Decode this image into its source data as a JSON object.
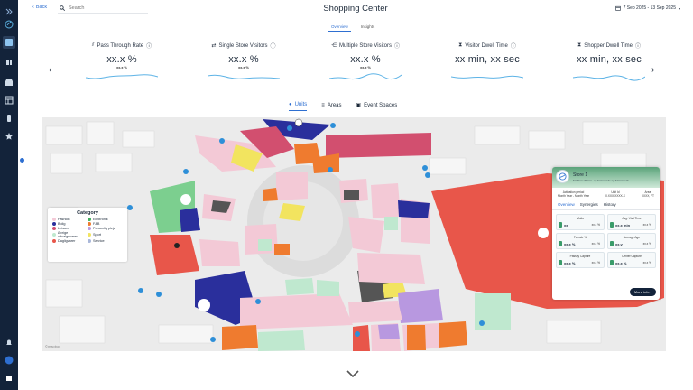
{
  "app": {
    "back_label": "Back",
    "search_placeholder": "Search",
    "title": "Shopping Center",
    "date_range": "7 Sep 2025 - 13 Sep 2025"
  },
  "subtabs": [
    {
      "label": "Overview",
      "active": true
    },
    {
      "label": "Insights",
      "active": false
    }
  ],
  "kpis": [
    {
      "title": "Pass Through Rate",
      "value": "xx.x %",
      "sub": "xx.x %",
      "icon": "chart-icon"
    },
    {
      "title": "Single Store Visitors",
      "value": "xx.x %",
      "sub": "xx.x %",
      "icon": "arrows-icon"
    },
    {
      "title": "Multiple Store Visitors",
      "value": "xx.x %",
      "sub": "xx.x %",
      "icon": "share-icon"
    },
    {
      "title": "Visitor Dwell Time",
      "value": "xx min, xx sec",
      "sub": "",
      "icon": "hourglass-icon"
    },
    {
      "title": "Shopper Dwell Time",
      "value": "xx min, xx sec",
      "sub": "",
      "icon": "hourglass-icon"
    }
  ],
  "map_tabs": [
    {
      "label": "Units",
      "active": true,
      "icon": "pin-icon"
    },
    {
      "label": "Areas",
      "active": false,
      "icon": "layers-icon"
    },
    {
      "label": "Event Spaces",
      "active": false,
      "icon": "calendar-icon"
    }
  ],
  "legend": {
    "title": "Category",
    "items": [
      {
        "label": "Fashion",
        "color": "#f3c9d6"
      },
      {
        "label": "Elektronik",
        "color": "#3fae5c"
      },
      {
        "label": "Bolig",
        "color": "#2a2f9c"
      },
      {
        "label": "F&B",
        "color": "#ef7b2f"
      },
      {
        "label": "Leisure",
        "color": "#d24f6f"
      },
      {
        "label": "Personlig pleje",
        "color": "#b898e0"
      },
      {
        "label": "Øvrige udvalgsvarer",
        "color": "#bfe8cf"
      },
      {
        "label": "Sport",
        "color": "#f2e45f"
      },
      {
        "label": "Dagligvarer",
        "color": "#e8564a"
      },
      {
        "label": "Service",
        "color": "#a9b7d9"
      }
    ]
  },
  "store_card": {
    "name": "Store 1",
    "subtitle": "Fashion / Dame- og herremode og børnemode",
    "info": [
      {
        "label": "Activation period",
        "value": "Month Year - Month Year"
      },
      {
        "label": "Unit Id",
        "value": "0.XXX-XXXX-X"
      },
      {
        "label": "Area",
        "value": "XXXX, FT"
      }
    ],
    "tabs": [
      {
        "label": "Overview",
        "active": true
      },
      {
        "label": "Synergies",
        "active": false
      },
      {
        "label": "History",
        "active": false
      }
    ],
    "metrics": [
      {
        "label": "Visits",
        "value": "xx",
        "compare": "xx.x %"
      },
      {
        "label": "Avg. Visit Time",
        "value": "xx.x min",
        "compare": "xx.x %"
      },
      {
        "label": "Female %",
        "value": "xx.x %",
        "compare": "xx.x %"
      },
      {
        "label": "Average Age",
        "value": "xx.y",
        "compare": "xx.x %"
      },
      {
        "label": "Passby Capture",
        "value": "xx.x %",
        "compare": "xx.x %"
      },
      {
        "label": "Center Capture",
        "value": "xx.x %",
        "compare": "xx.x %"
      }
    ],
    "more_label": "More info"
  },
  "map_attribution": "©mapbox",
  "colors": {
    "sidebar": "#13233a",
    "accent": "#2e6fd1",
    "store_card_header": "#5aa37a"
  }
}
